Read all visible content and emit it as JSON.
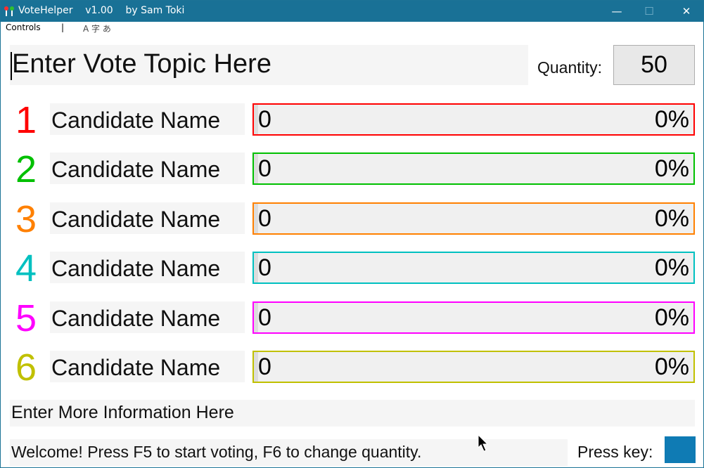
{
  "window": {
    "title": "VoteHelper    v1.00    by Sam Toki",
    "minimize_glyph": "—",
    "maximize_glyph": "☐",
    "close_glyph": "✕"
  },
  "menu": {
    "controls": "Controls",
    "separator": "|",
    "ime_indicator": "A 字 あ"
  },
  "topic": {
    "text": "Enter Vote Topic Here"
  },
  "quantity": {
    "label": "Quantity:",
    "value": "50"
  },
  "candidates": [
    {
      "number": "1",
      "name": "Candidate Name",
      "votes": "0",
      "percent": "0%",
      "color": "#ff0000"
    },
    {
      "number": "2",
      "name": "Candidate Name",
      "votes": "0",
      "percent": "0%",
      "color": "#00c000"
    },
    {
      "number": "3",
      "name": "Candidate Name",
      "votes": "0",
      "percent": "0%",
      "color": "#ff8000"
    },
    {
      "number": "4",
      "name": "Candidate Name",
      "votes": "0",
      "percent": "0%",
      "color": "#00c0c0"
    },
    {
      "number": "5",
      "name": "Candidate Name",
      "votes": "0",
      "percent": "0%",
      "color": "#ff00ff"
    },
    {
      "number": "6",
      "name": "Candidate Name",
      "votes": "0",
      "percent": "0%",
      "color": "#c0c000"
    }
  ],
  "info": {
    "text": "Enter More Information Here"
  },
  "status": {
    "text": "Welcome! Press F5 to start voting, F6 to change quantity.",
    "press_key_label": "Press key:",
    "key_indicator_color": "#0f7bb4"
  },
  "colors": {
    "titlebar": "#197196",
    "field_background": "#f5f5f5"
  }
}
